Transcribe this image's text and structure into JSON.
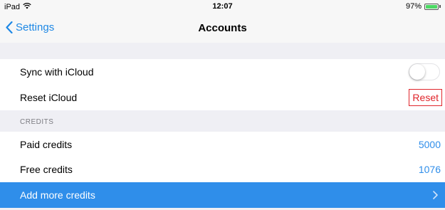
{
  "status_bar": {
    "device": "iPad",
    "wifi_icon": "wifi-icon",
    "time": "12:07",
    "battery_text": "97%",
    "battery_level": 0.97,
    "battery_color": "#4cd964"
  },
  "nav": {
    "back_label": "Settings",
    "back_icon": "chevron-left-icon",
    "title": "Accounts"
  },
  "rows": {
    "sync_icloud": {
      "label": "Sync with iCloud",
      "toggle_on": false
    },
    "reset_icloud": {
      "label": "Reset iCloud",
      "button_label": "Reset"
    }
  },
  "credits_section": {
    "header": "CREDITS",
    "paid": {
      "label": "Paid credits",
      "value": "5000"
    },
    "free": {
      "label": "Free credits",
      "value": "1076"
    },
    "add_more": {
      "label": "Add more credits",
      "chevron_icon": "chevron-right-icon"
    }
  },
  "colors": {
    "accent": "#2f8eea",
    "destructive": "#e0252b",
    "group_background": "#efeff4"
  }
}
